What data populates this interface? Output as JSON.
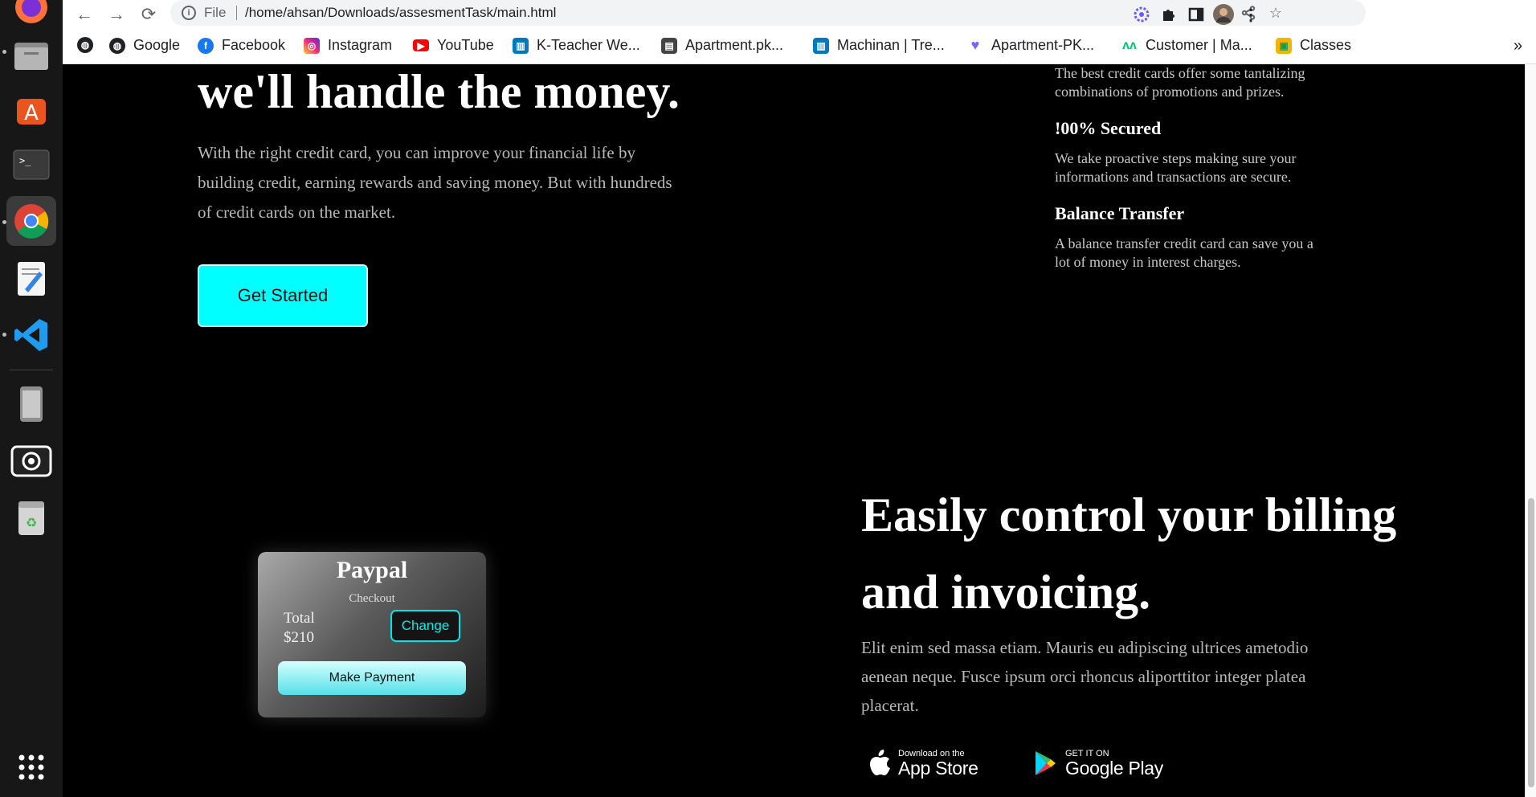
{
  "dock": {
    "items": [
      "firefox",
      "files",
      "software",
      "terminal",
      "chrome",
      "text-editor",
      "vscode",
      "phone",
      "screenshot",
      "trash",
      "app-grid"
    ]
  },
  "browser": {
    "omnibox": {
      "scheme_label": "File",
      "url": "/home/ahsan/Downloads/assesmentTask/main.html"
    },
    "bookmarks": [
      {
        "label": "",
        "icon": "globe-icon"
      },
      {
        "label": "Google",
        "icon": "globe-icon"
      },
      {
        "label": "Facebook",
        "icon": "facebook-icon",
        "color": "#1877f2"
      },
      {
        "label": "Instagram",
        "icon": "instagram-icon",
        "color": "#e1306c"
      },
      {
        "label": "YouTube",
        "icon": "youtube-icon",
        "color": "#ff0000"
      },
      {
        "label": "K-Teacher We...",
        "icon": "trello-icon",
        "color": "#0079bf"
      },
      {
        "label": "Apartment.pk...",
        "icon": "doc-icon",
        "color": "#444444"
      },
      {
        "label": "Machinan | Tre...",
        "icon": "trello-icon",
        "color": "#0079bf"
      },
      {
        "label": "Apartment-PK...",
        "icon": "heart-icon",
        "color": "#7b61ff"
      },
      {
        "label": "Customer | Ma...",
        "icon": "monday-icon",
        "color": "#00c875"
      },
      {
        "label": "Classes",
        "icon": "classroom-icon",
        "color": "#f4b400"
      }
    ],
    "overflow_label": "»"
  },
  "hero": {
    "title": "we'll handle the money.",
    "text": "With the right credit card, you can improve your financial life by building credit, earning rewards and saving money. But with hundreds of credit cards on the market.",
    "cta_label": "Get Started"
  },
  "features": [
    {
      "title": "",
      "text": "The best credit cards offer some tantalizing combinations of promotions and prizes."
    },
    {
      "title": "!00% Secured",
      "text": "We take proactive steps making sure your informations and transactions are secure."
    },
    {
      "title": "Balance Transfer",
      "text": "A balance transfer credit card can save you a lot of money in interest charges."
    }
  ],
  "payment_card": {
    "title": "Paypal",
    "subtitle": "Checkout",
    "total_label": "Total",
    "total_value": "$210",
    "change_label": "Change",
    "pay_label": "Make Payment"
  },
  "billing": {
    "title": "Easily control your billing and invoicing.",
    "text": "Elit enim sed massa etiam. Mauris eu adipiscing ultrices ametodio aenean neque. Fusce ipsum orci rhoncus aliporttitor integer platea placerat.",
    "app_store": {
      "small": "Download on the",
      "big": "App Store"
    },
    "google_play": {
      "small": "GET IT ON",
      "big": "Google Play"
    }
  },
  "colors": {
    "accent_cyan": "#00ffff",
    "page_bg": "#000000"
  }
}
